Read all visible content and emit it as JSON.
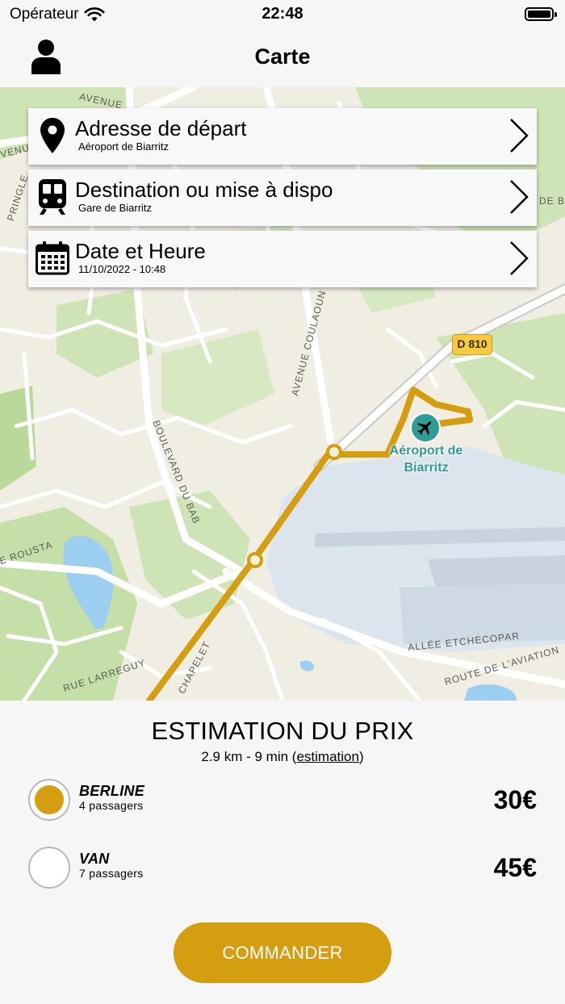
{
  "status_bar": {
    "carrier": "Opérateur",
    "time": "22:48"
  },
  "nav": {
    "title": "Carte",
    "profile_icon": "user-icon"
  },
  "map": {
    "road_badge": "D 810",
    "airport_name": "Aéroport de Biarritz",
    "street_labels": {
      "avenue_top": "AVENUE",
      "venu_left": "VENU",
      "pringle": "PRINGLE",
      "de_b": "DE B",
      "avenue_coulaoun": "AVENUE COULAOUN",
      "boulevard_bab": "BOULEVARD DU BAB",
      "roustan": "E ROUSTA",
      "allee_etchecopar": "ALLÉE ETCHECOPAR",
      "route_aviation": "ROUTE DE L'AVIATION",
      "rue_larreguy": "RUE LARREGUY",
      "chapelet": "CHAPELET"
    },
    "route_color": "#d59e10"
  },
  "cards": {
    "departure": {
      "title": "Adresse de départ",
      "subtitle": "Aéroport de Biarritz",
      "icon": "map-pin-icon"
    },
    "destination": {
      "title": "Destination ou mise à dispo",
      "subtitle": "Gare de Biarritz",
      "icon": "train-icon"
    },
    "datetime": {
      "title": "Date et Heure",
      "subtitle": "11/10/2022 - 10:48",
      "icon": "calendar-icon"
    }
  },
  "estimate": {
    "title": "ESTIMATION DU PRIX",
    "summary": "2.9 km - 9 min",
    "link_open": "(",
    "link_label": "estimation",
    "link_close": ")"
  },
  "options": [
    {
      "name": "BERLINE",
      "passengers": "4 passagers",
      "price": "30€",
      "selected": true
    },
    {
      "name": "VAN",
      "passengers": "7 passagers",
      "price": "45€",
      "selected": false
    }
  ],
  "order_button": "COMMANDER",
  "colors": {
    "accent": "#d59e10",
    "airport_teal": "#2e9d97"
  }
}
